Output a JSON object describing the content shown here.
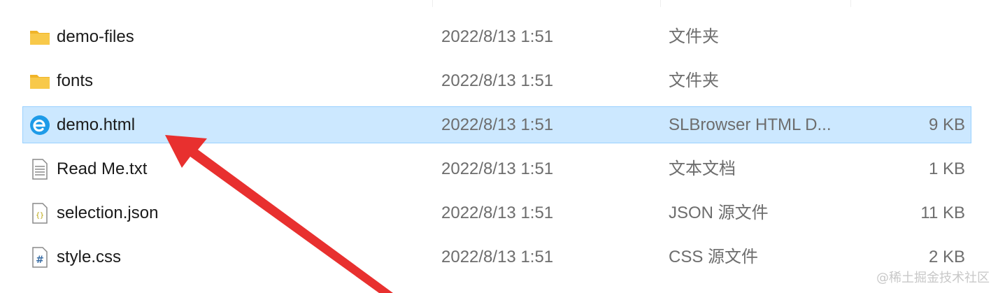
{
  "files": [
    {
      "name": "demo-files",
      "date": "2022/8/13 1:51",
      "type": "文件夹",
      "size": "",
      "icon": "folder-icon"
    },
    {
      "name": "fonts",
      "date": "2022/8/13 1:51",
      "type": "文件夹",
      "size": "",
      "icon": "folder-icon"
    },
    {
      "name": "demo.html",
      "date": "2022/8/13 1:51",
      "type": "SLBrowser HTML D...",
      "size": "9 KB",
      "icon": "browser-html-icon",
      "selected": true
    },
    {
      "name": "Read Me.txt",
      "date": "2022/8/13 1:51",
      "type": "文本文档",
      "size": "1 KB",
      "icon": "text-file-icon"
    },
    {
      "name": "selection.json",
      "date": "2022/8/13 1:51",
      "type": "JSON 源文件",
      "size": "11 KB",
      "icon": "json-file-icon"
    },
    {
      "name": "style.css",
      "date": "2022/8/13 1:51",
      "type": "CSS 源文件",
      "size": "2 KB",
      "icon": "css-file-icon"
    }
  ],
  "watermark": "@稀土掘金技术社区",
  "colors": {
    "selection_bg": "#cce8ff",
    "selection_border": "#99d1ff",
    "arrow": "#e8302f",
    "folder": "#f8c94a"
  }
}
